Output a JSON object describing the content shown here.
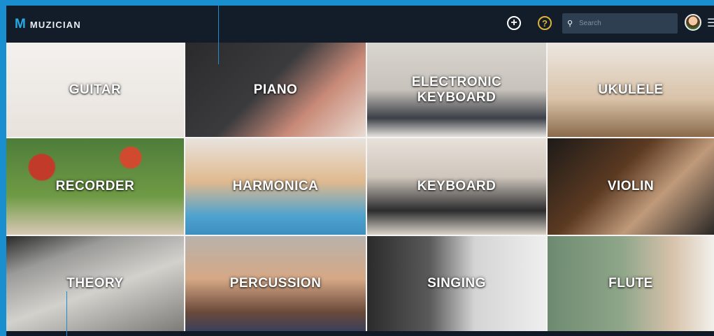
{
  "app": {
    "logo_mark": "M",
    "logo_text": "MUZICIAN"
  },
  "toolbar": {
    "add_glyph": "+",
    "help_glyph": "?",
    "search_icon": "search-icon",
    "search_placeholder": "Search"
  },
  "instruments": [
    {
      "label": "GUITAR"
    },
    {
      "label": "PIANO"
    },
    {
      "label": "ELECTRONIC KEYBOARD"
    },
    {
      "label": "UKULELE"
    },
    {
      "label": "RECORDER"
    },
    {
      "label": "HARMONICA"
    },
    {
      "label": "KEYBOARD"
    },
    {
      "label": "VIOLIN"
    },
    {
      "label": "THEORY"
    },
    {
      "label": "PERCUSSION"
    },
    {
      "label": "SINGING"
    },
    {
      "label": "FLUTE"
    }
  ],
  "colors": {
    "frame": "#1a8fcf",
    "topbar": "#121d29",
    "logo_accent": "#27a9e1",
    "help_accent": "#e0b233"
  }
}
